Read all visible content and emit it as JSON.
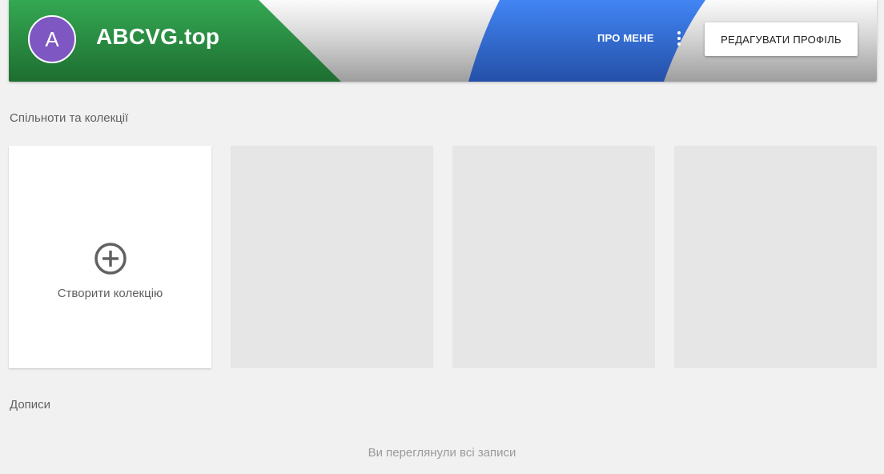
{
  "header": {
    "avatar_letter": "A",
    "profile_name": "ABCVG.top",
    "about_label": "ПРО МЕНЕ",
    "edit_profile_label": "РЕДАГУВАТИ ПРОФІЛЬ",
    "more_icon": "more-vert-icon"
  },
  "colors": {
    "avatar": "#7e57c2",
    "banner_green": "#2e9a47",
    "banner_blue": "#3b73d9",
    "banner_gray": "#d9d9d9",
    "page_background": "#f1f1f1",
    "placeholder_card": "#e6e6e6"
  },
  "communities": {
    "title": "Спільноти та колекції",
    "create_card": {
      "icon": "add-circle-icon",
      "label": "Створити колекцію"
    },
    "placeholder_count": 3
  },
  "posts": {
    "title": "Дописи",
    "end_message": "Ви переглянули всі записи"
  }
}
